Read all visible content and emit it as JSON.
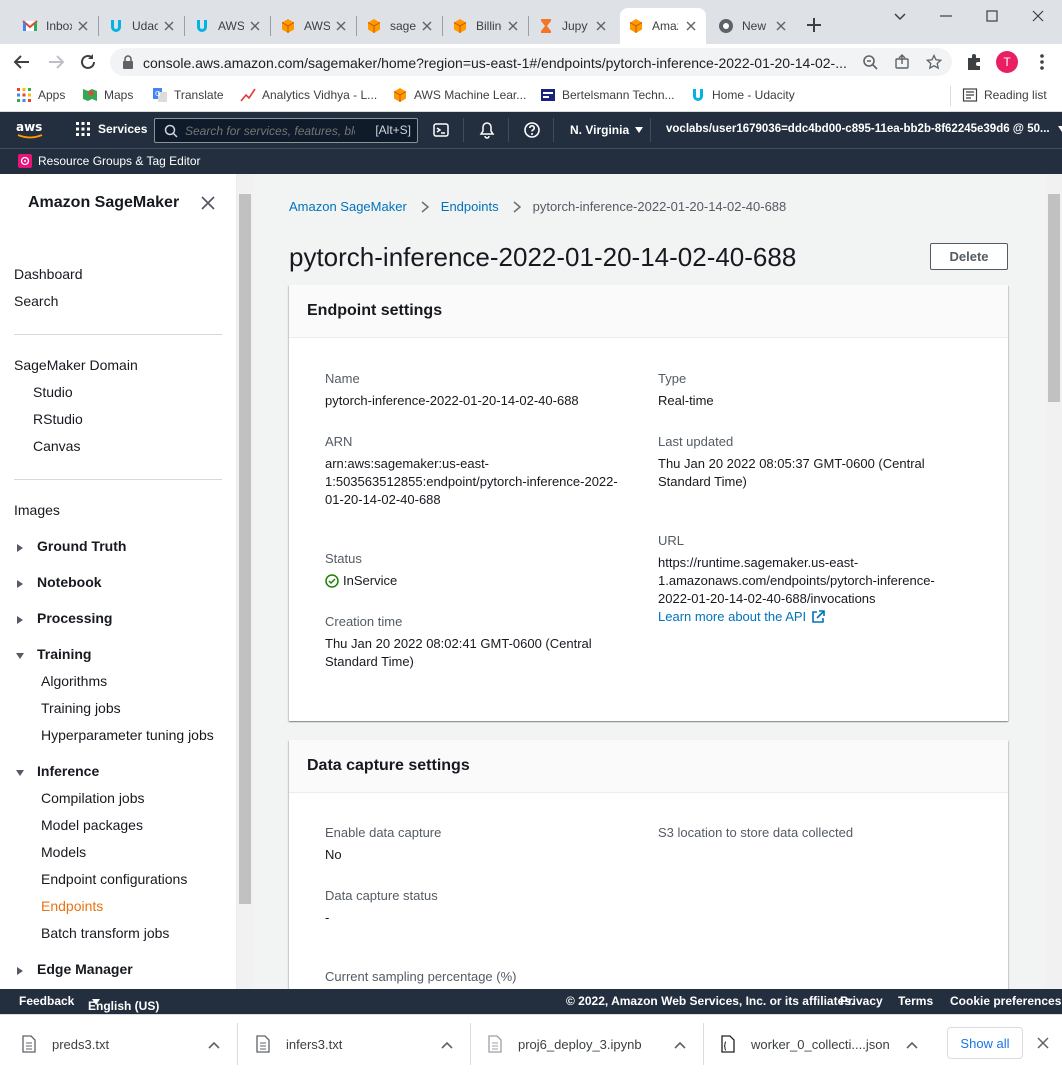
{
  "browser": {
    "tabs": [
      {
        "label": "Inbox",
        "icon": "gmail-icon"
      },
      {
        "label": "Udacity",
        "icon": "udacity-icon"
      },
      {
        "label": "AWS",
        "icon": "udacity-icon"
      },
      {
        "label": "AWS",
        "icon": "aws-cube-icon"
      },
      {
        "label": "sagemaker",
        "icon": "aws-cube-icon"
      },
      {
        "label": "Billing",
        "icon": "aws-cube-icon"
      },
      {
        "label": "Jupyter",
        "icon": "hourglass-icon"
      },
      {
        "label": "Amazon",
        "icon": "aws-cube-icon",
        "active": true
      },
      {
        "label": "New Tab",
        "icon": "chrome-icon"
      }
    ],
    "url": "console.aws.amazon.com/sagemaker/home?region=us-east-1#/endpoints/pytorch-inference-2022-01-20-14-02-...",
    "profile_initial": "T",
    "bookmarks": [
      "Apps",
      "Maps",
      "Translate",
      "Analytics Vidhya - L...",
      "AWS Machine Lear...",
      "Bertelsmann Techn...",
      "Home - Udacity"
    ],
    "reading_list": "Reading list"
  },
  "aws_header": {
    "services": "Services",
    "search_placeholder": "Search for services, features, blogs, docs, and more",
    "search_shortcut": "[Alt+S]",
    "region": "N. Virginia",
    "account": "voclabs/user1679036=ddc4bd00-c895-11ea-bb2b-8f62245e39d6 @ 50...",
    "resource_groups": "Resource Groups & Tag Editor"
  },
  "sidebar": {
    "title": "Amazon SageMaker",
    "dashboard": "Dashboard",
    "search": "Search",
    "domain": "SageMaker Domain",
    "studio": "Studio",
    "rstudio": "RStudio",
    "canvas": "Canvas",
    "images": "Images",
    "ground_truth": "Ground Truth",
    "notebook": "Notebook",
    "processing": "Processing",
    "training": "Training",
    "algorithms": "Algorithms",
    "training_jobs": "Training jobs",
    "hpo": "Hyperparameter tuning jobs",
    "inference": "Inference",
    "compilation": "Compilation jobs",
    "model_packages": "Model packages",
    "models": "Models",
    "endpoint_configs": "Endpoint configurations",
    "endpoints": "Endpoints",
    "batch": "Batch transform jobs",
    "edge": "Edge Manager"
  },
  "breadcrumb": {
    "root": "Amazon SageMaker",
    "section": "Endpoints",
    "current": "pytorch-inference-2022-01-20-14-02-40-688"
  },
  "page": {
    "title": "pytorch-inference-2022-01-20-14-02-40-688",
    "delete": "Delete"
  },
  "endpoint_settings": {
    "heading": "Endpoint settings",
    "name_label": "Name",
    "name": "pytorch-inference-2022-01-20-14-02-40-688",
    "type_label": "Type",
    "type": "Real-time",
    "arn_label": "ARN",
    "arn_line1": "arn:aws:sagemaker:us-east-",
    "arn_line2": "1:503563512855:endpoint/pytorch-inference-2022-",
    "arn_line3": "01-20-14-02-40-688",
    "updated_label": "Last updated",
    "updated_line1": "Thu Jan 20 2022 08:05:37 GMT-0600 (Central",
    "updated_line2": "Standard Time)",
    "status_label": "Status",
    "status": "InService",
    "url_label": "URL",
    "url_line1": "https://runtime.sagemaker.us-east-",
    "url_line2": "1.amazonaws.com/endpoints/pytorch-inference-",
    "url_line3": "2022-01-20-14-02-40-688/invocations",
    "learn_more": "Learn more about the API",
    "created_label": "Creation time",
    "created_line1": "Thu Jan 20 2022 08:02:41 GMT-0600 (Central",
    "created_line2": "Standard Time)"
  },
  "data_capture": {
    "heading": "Data capture settings",
    "enable_label": "Enable data capture",
    "enable": "No",
    "s3_label": "S3 location to store data collected",
    "status_label": "Data capture status",
    "status": "-",
    "sampling_label": "Current sampling percentage (%)"
  },
  "footer": {
    "feedback": "Feedback",
    "language": "English (US)",
    "copyright": "© 2022, Amazon Web Services, Inc. or its affiliates.",
    "privacy": "Privacy",
    "terms": "Terms",
    "cookies": "Cookie preferences"
  },
  "downloads": {
    "items": [
      "preds3.txt",
      "infers3.txt",
      "proj6_deploy_3.ipynb",
      "worker_0_collecti....json"
    ],
    "show_all": "Show all"
  },
  "colors": {
    "aws_nav": "#232f3e",
    "link": "#0073bb",
    "active_nav": "#ec7211",
    "status_ok": "#1d8102"
  }
}
